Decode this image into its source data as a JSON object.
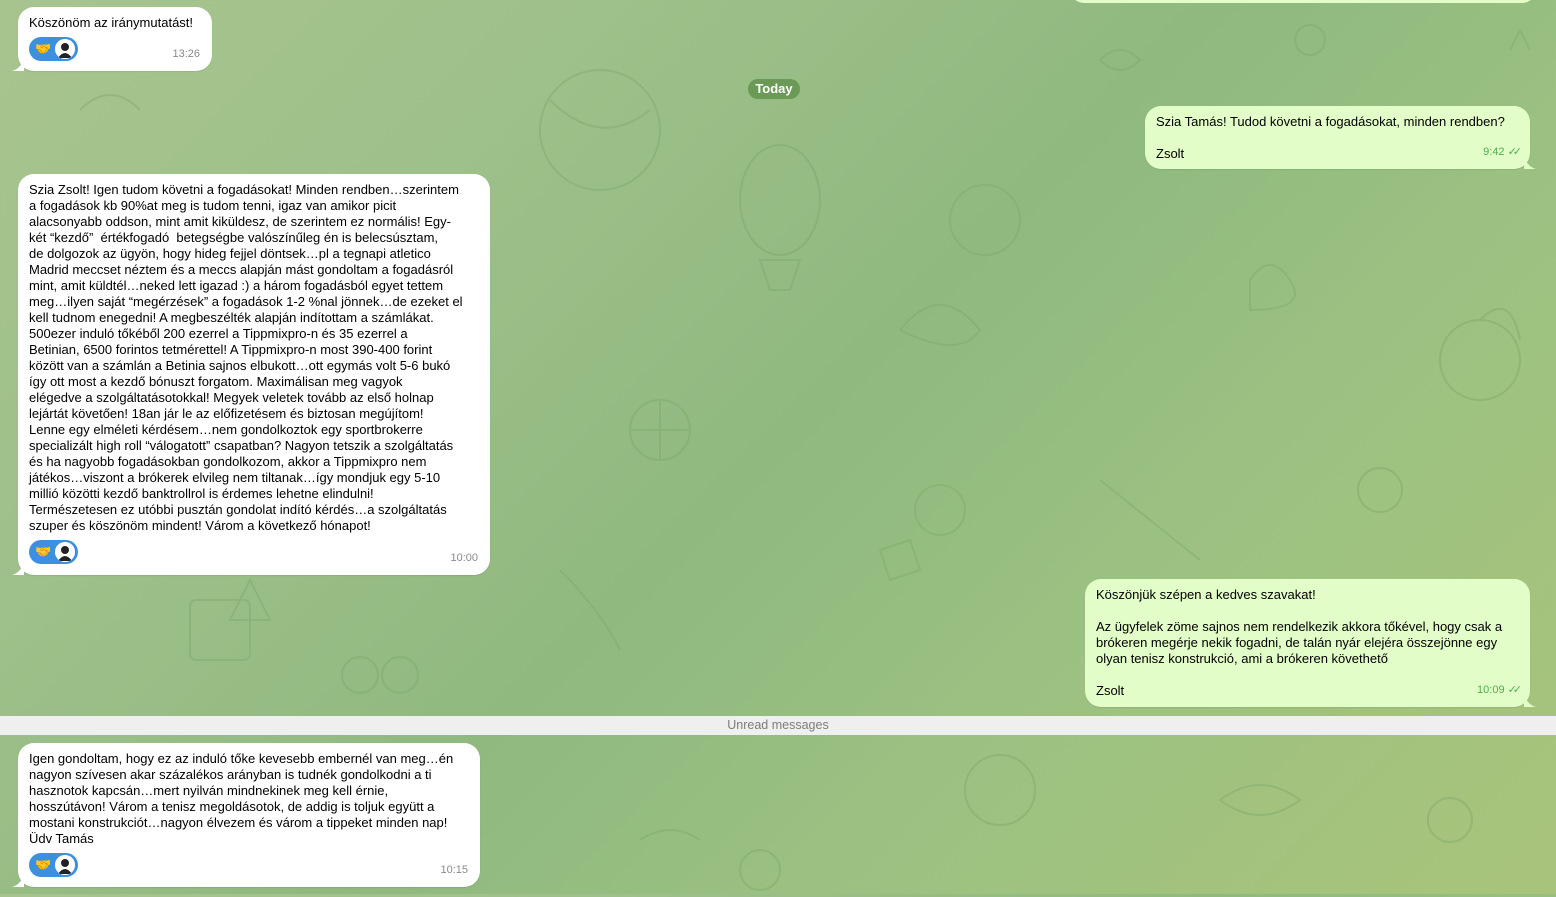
{
  "chat": {
    "date_separator": "Today",
    "unread_label": "Unread messages"
  },
  "messages": [
    {
      "text": "Köszönöm az iránymutatást!",
      "time": "13:26",
      "reaction": "🤝"
    },
    {
      "text": "Szia Tamás! Tudod követni a fogadásokat, minden rendben?\n\nZsolt",
      "time": "9:42"
    },
    {
      "text": "Szia Zsolt! Igen tudom követni a fogadásokat! Minden rendben…szerintem\na fogadások kb 90%at meg is tudom tenni, igaz van amikor picit\nalacsonyabb oddson, mint amit kiküldesz, de szerintem ez normális! Egy-\nkét “kezdő”  értékfogadó  betegségbe valószínűleg én is belecsúsztam,\nde dolgozok az ügyön, hogy hideg fejjel döntsek…pl a tegnapi atletico\nMadrid meccset néztem és a meccs alapján mást gondoltam a fogadásról\nmint, amit küldtél…neked lett igazad :) a három fogadásból egyet tettem\nmeg…ilyen saját “megérzések” a fogadások 1-2 %nal jönnek…de ezeket el\nkell tudnom enegedni! A megbeszélték alapján indítottam a számlákat.\n500ezer induló tőkéből 200 ezerrel a Tippmixpro-n és 35 ezerrel a\nBetinian, 6500 forintos tetmérettel! A Tippmixpro-n most 390-400 forint\nközött van a számlán a Betinia sajnos elbukott…ott egymás volt 5-6 bukó\nígy ott most a kezdő bónuszt forgatom. Maximálisan meg vagyok\nelégedve a szolgáltatásotokkal! Megyek veletek tovább az első holnap\nlejártát követően! 18an jár le az előfizetésem és biztosan megújítom!\nLenne egy elméleti kérdésem…nem gondolkoztok egy sportbrokerre\nspecializált high roll “válogatott” csapatban? Nagyon tetszik a szolgáltatás\nés ha nagyobb fogadásokban gondolkozom, akkor a Tippmixpro nem\njátékos…viszont a brókerek elvileg nem tiltanak…így mondjuk egy 5-10\nmillió közötti kezdő banktrollrol is érdemes lehetne elindulni!\nTermészetesen ez utóbbi pusztán gondolat indító kérdés…a szolgáltatás\nszuper és köszönöm mindent! Várom a következő hónapot!",
      "time": "10:00",
      "reaction": "🤝"
    },
    {
      "text": "Köszönjük szépen a kedves szavakat!\n\nAz ügyfelek zöme sajnos nem rendelkezik akkora tőkével, hogy csak a\nbrókeren megérje nekik fogadni, de talán nyár elejéra összejönne egy\nolyan tenisz konstrukció, ami a brókeren követhető\n\nZsolt",
      "time": "10:09"
    },
    {
      "text": "Igen gondoltam, hogy ez az induló tőke kevesebb embernél van meg…én\nnagyon szívesen akar százalékos arányban is tudnék gondolkodni a ti\nhasznotok kapcsán…mert nyilván mindnekinek meg kell érnie,\nhosszútávon! Várom a tenisz megoldásotok, de addig is toljuk együtt a\nmostani konstrukciót…nagyon élvezem és várom a tippeket minden nap!\nÜdv Tamás",
      "time": "10:15",
      "reaction": "🤝"
    }
  ],
  "colors": {
    "incoming_bubble": "#ffffff",
    "outgoing_bubble": "#e3fdc8",
    "reaction_pill": "#3d8fe0",
    "today_pill": "#6a9a56",
    "outgoing_time": "#4caf50"
  },
  "icons": {
    "reaction_avatar": "user-avatar-icon",
    "read_receipt": "double-check-icon"
  }
}
